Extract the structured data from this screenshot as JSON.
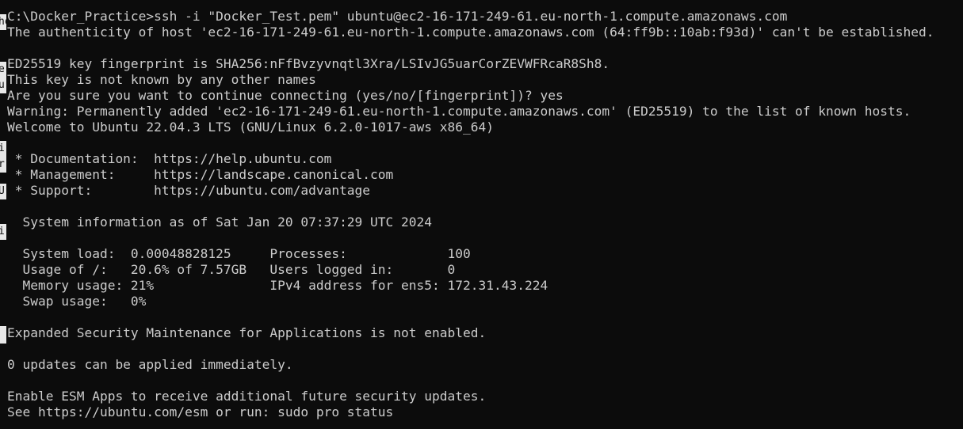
{
  "terminal": {
    "lines": [
      "C:\\Docker_Practice>ssh -i \"Docker_Test.pem\" ubuntu@ec2-16-171-249-61.eu-north-1.compute.amazonaws.com",
      "The authenticity of host 'ec2-16-171-249-61.eu-north-1.compute.amazonaws.com (64:ff9b::10ab:f93d)' can't be established.",
      "ED25519 key fingerprint is SHA256:nFfBvzyvnqtl3Xra/LSIvJG5uarCorZEVWFRcaR8Sh8.",
      "This key is not known by any other names",
      "Are you sure you want to continue connecting (yes/no/[fingerprint])? yes",
      "Warning: Permanently added 'ec2-16-171-249-61.eu-north-1.compute.amazonaws.com' (ED25519) to the list of known hosts.",
      "Welcome to Ubuntu 22.04.3 LTS (GNU/Linux 6.2.0-1017-aws x86_64)",
      "",
      " * Documentation:  https://help.ubuntu.com",
      " * Management:     https://landscape.canonical.com",
      " * Support:        https://ubuntu.com/advantage",
      "",
      "  System information as of Sat Jan 20 07:37:29 UTC 2024",
      "",
      "  System load:  0.00048828125     Processes:             100",
      "  Usage of /:   20.6% of 7.57GB   Users logged in:       0",
      "  Memory usage: 21%               IPv4 address for ens5: 172.31.43.224",
      "  Swap usage:   0%",
      "",
      "Expanded Security Maintenance for Applications is not enabled.",
      "",
      "0 updates can be applied immediately.",
      "",
      "Enable ESM Apps to receive additional future security updates.",
      "See https://ubuntu.com/esm or run: sudo pro status"
    ],
    "colors": {
      "background": "#0c0c0c",
      "foreground": "#cccccc"
    }
  },
  "background_window": {
    "fragments": [
      "ho",
      "e",
      "u",
      "i",
      "ir",
      "r",
      "U",
      "i"
    ]
  }
}
